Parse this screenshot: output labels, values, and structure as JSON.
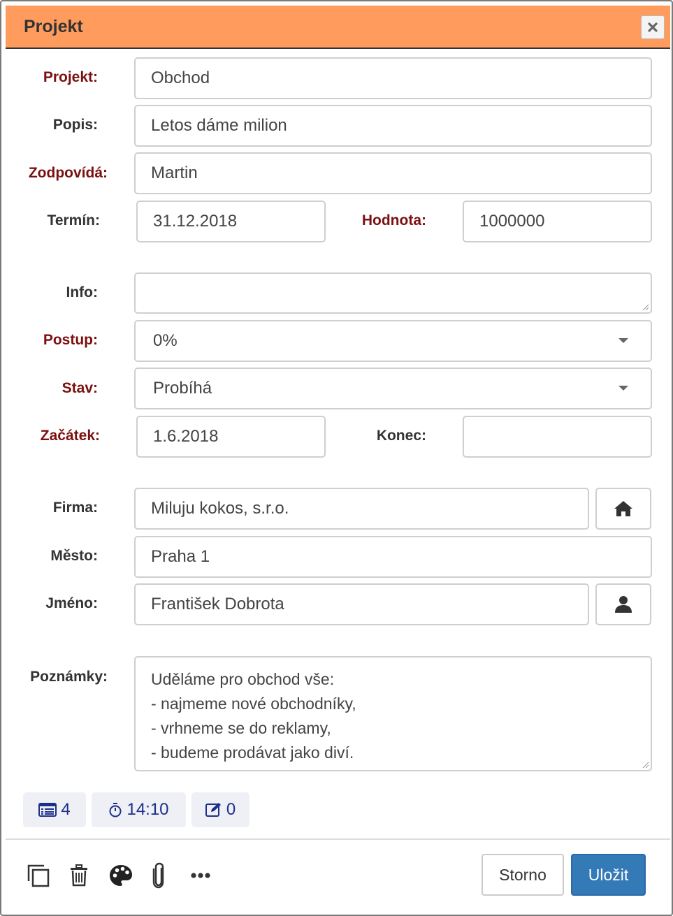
{
  "dialog": {
    "title": "Projekt",
    "close_icon": "close-icon"
  },
  "form": {
    "projekt": {
      "label": "Projekt:",
      "value": "Obchod",
      "required": true
    },
    "popis": {
      "label": "Popis:",
      "value": "Letos dáme milion",
      "required": false
    },
    "zodpovida": {
      "label": "Zodpovídá:",
      "value": "Martin",
      "required": true
    },
    "termin": {
      "label": "Termín:",
      "value": "31.12.2018",
      "required": false
    },
    "hodnota": {
      "label": "Hodnota:",
      "value": "1000000",
      "required": true
    },
    "info": {
      "label": "Info:",
      "value": "",
      "required": false
    },
    "postup": {
      "label": "Postup:",
      "value": "0%",
      "required": true
    },
    "stav": {
      "label": "Stav:",
      "value": "Probíhá",
      "required": true
    },
    "zacatek": {
      "label": "Začátek:",
      "value": "1.6.2018",
      "required": true
    },
    "konec": {
      "label": "Konec:",
      "value": "",
      "required": false
    },
    "firma": {
      "label": "Firma:",
      "value": "Miluju kokos, s.r.o.",
      "button_icon": "home-icon"
    },
    "mesto": {
      "label": "Město:",
      "value": "Praha 1"
    },
    "jmeno": {
      "label": "Jméno:",
      "value": "František Dobrota",
      "button_icon": "person-icon"
    },
    "poznamky": {
      "label": "Poznámky:",
      "lines": [
        "Uděláme pro obchod vše:",
        "- najmeme nové obchodníky,",
        "- vrhneme se do reklamy,",
        "- budeme prodávat jako diví."
      ]
    }
  },
  "chips": [
    {
      "icon": "list-icon",
      "value": "4"
    },
    {
      "icon": "stopwatch-icon",
      "value": "14:10"
    },
    {
      "icon": "edit-icon",
      "value": "0"
    }
  ],
  "toolbar": {
    "icons": [
      "copy-icon",
      "trash-icon",
      "palette-icon",
      "paperclip-icon",
      "more-icon"
    ]
  },
  "buttons": {
    "cancel_label": "Storno",
    "save_label": "Uložit"
  },
  "colors": {
    "titlebar": "#ff9c5d",
    "required_label": "#7b1010",
    "primary_button": "#337ab7",
    "chip_text": "#1d2f8a"
  }
}
